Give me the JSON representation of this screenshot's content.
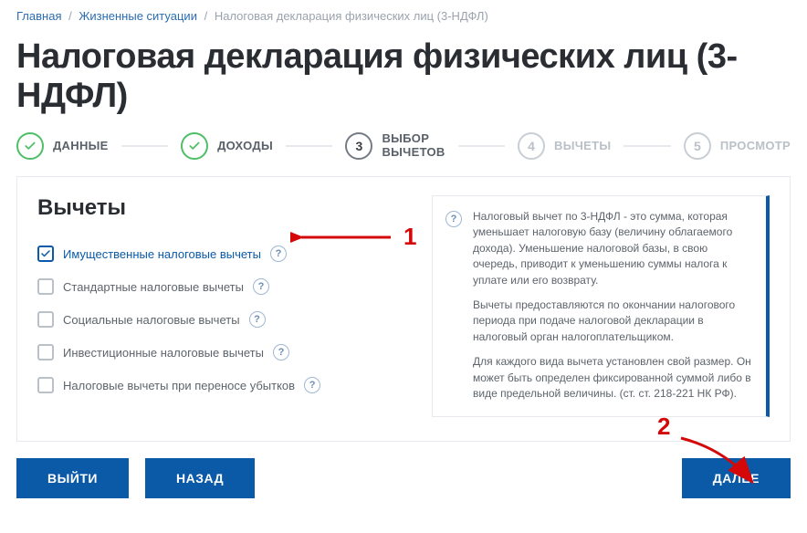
{
  "breadcrumb": {
    "home": "Главная",
    "situations": "Жизненные ситуации",
    "current": "Налоговая декларация физических лиц (3-НДФЛ)"
  },
  "title": "Налоговая декларация физических лиц (3-НДФЛ)",
  "steps": [
    {
      "num": "✓",
      "label": "ДАННЫЕ",
      "state": "done"
    },
    {
      "num": "✓",
      "label": "ДОХОДЫ",
      "state": "done"
    },
    {
      "num": "3",
      "label": "ВЫБОР\nВЫЧЕТОВ",
      "state": "current"
    },
    {
      "num": "4",
      "label": "ВЫЧЕТЫ",
      "state": "upcoming"
    },
    {
      "num": "5",
      "label": "ПРОСМОТР",
      "state": "upcoming"
    }
  ],
  "section_title": "Вычеты",
  "deductions": [
    {
      "label": "Имущественные налоговые вычеты",
      "checked": true
    },
    {
      "label": "Стандартные налоговые вычеты",
      "checked": false
    },
    {
      "label": "Социальные налоговые вычеты",
      "checked": false
    },
    {
      "label": "Инвестиционные налоговые вычеты",
      "checked": false
    },
    {
      "label": "Налоговые вычеты при переносе убытков",
      "checked": false
    }
  ],
  "info": {
    "p1": "Налоговый вычет по 3-НДФЛ - это сумма, которая уменьшает налоговую базу (величину облагаемого дохода). Уменьшение налоговой базы, в свою очередь, приводит к уменьшению суммы налога к уплате или его возврату.",
    "p2": "Вычеты предоставляются по окончании налогового периода при подаче налоговой декларации в налоговый орган налогоплательщиком.",
    "p3": "Для каждого вида вычета установлен свой размер. Он может быть определен фиксированной суммой либо в виде предельной величины. (ст. ст. 218-221 НК РФ)."
  },
  "buttons": {
    "exit": "ВЫЙТИ",
    "back": "НАЗАД",
    "next": "ДАЛЕЕ"
  },
  "annotations": {
    "n1": "1",
    "n2": "2"
  }
}
